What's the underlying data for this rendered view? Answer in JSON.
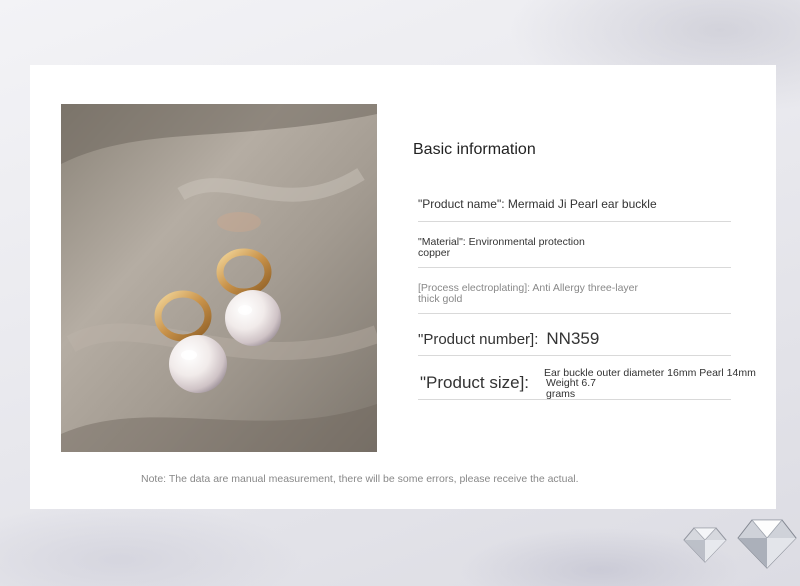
{
  "heading": "Basic information",
  "rows": {
    "product_name": "\"Product name\": Mermaid Ji Pearl ear buckle",
    "material_line1": "\"Material\": Environmental protection",
    "material_line2": "copper",
    "process_line1": "[Process electroplating]: Anti Allergy three-layer",
    "process_line2": "thick gold",
    "product_number_label": "\"Product number]:",
    "product_number_value": "NN359",
    "product_size_label": "\"Product size]:",
    "product_size_value_line1": "Ear buckle outer diameter 16mm Pearl 14mm",
    "product_size_value_line2": "Weight 6.7 grams"
  },
  "note": "Note: The data are manual measurement, there will be some errors, please receive the actual.",
  "colors": {
    "card": "#ffffff",
    "gold": "#c8924a",
    "pearl": "#f2ecec"
  },
  "icons": [
    "pearl-earring-photo",
    "diamond-icon"
  ]
}
